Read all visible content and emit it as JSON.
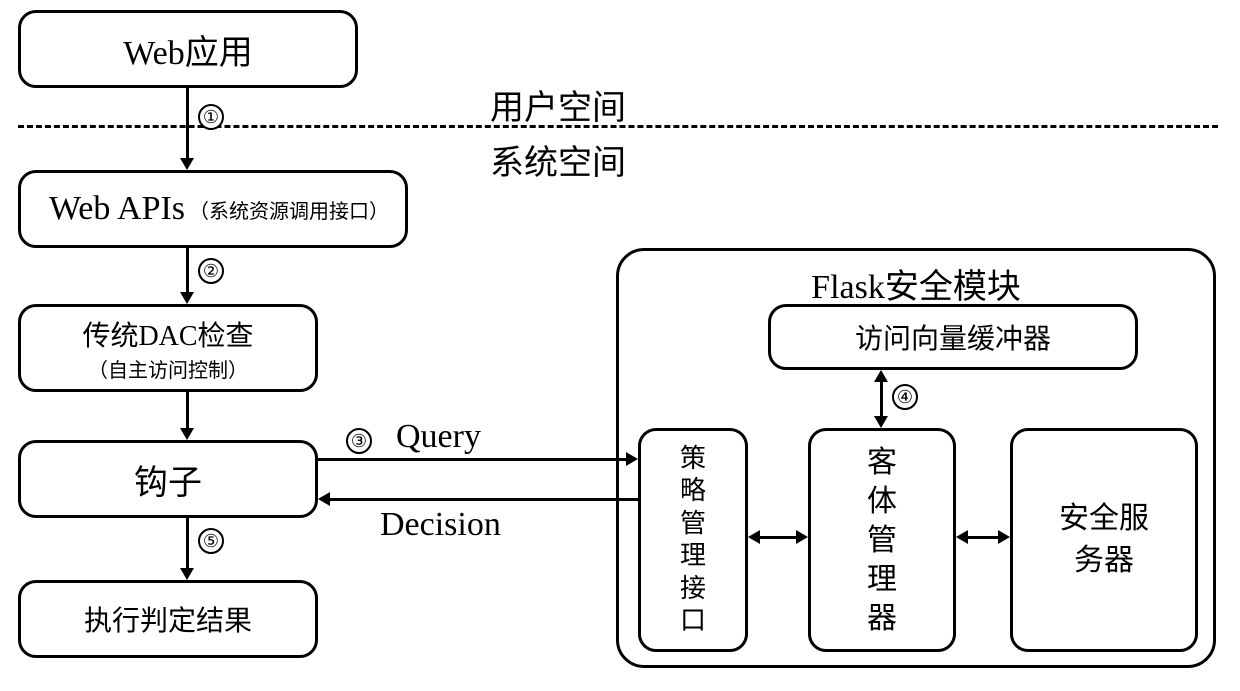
{
  "boxes": {
    "web_app": "Web应用",
    "web_apis_main": "Web APIs",
    "web_apis_sub": "（系统资源调用接口）",
    "dac_main": "传统DAC检查",
    "dac_sub": "（自主访问控制）",
    "hook": "钩子",
    "exec_result": "执行判定结果",
    "flask_title": "Flask安全模块",
    "avc": "访问向量缓冲器",
    "policy_if_l1": "策",
    "policy_if_l2": "略",
    "policy_if_l3": "管",
    "policy_if_l4": "理",
    "policy_if_l5": "接",
    "policy_if_l6": "口",
    "obj_mgr_l1": "客",
    "obj_mgr_l2": "体",
    "obj_mgr_l3": "管",
    "obj_mgr_l4": "理",
    "obj_mgr_l5": "器",
    "sec_srv_l1": "安全服",
    "sec_srv_l2": "务器"
  },
  "labels": {
    "user_space": "用户空间",
    "system_space": "系统空间",
    "query": "Query",
    "decision": "Decision"
  },
  "steps": {
    "s1": "①",
    "s2": "②",
    "s3": "③",
    "s4": "④",
    "s5": "⑤"
  }
}
